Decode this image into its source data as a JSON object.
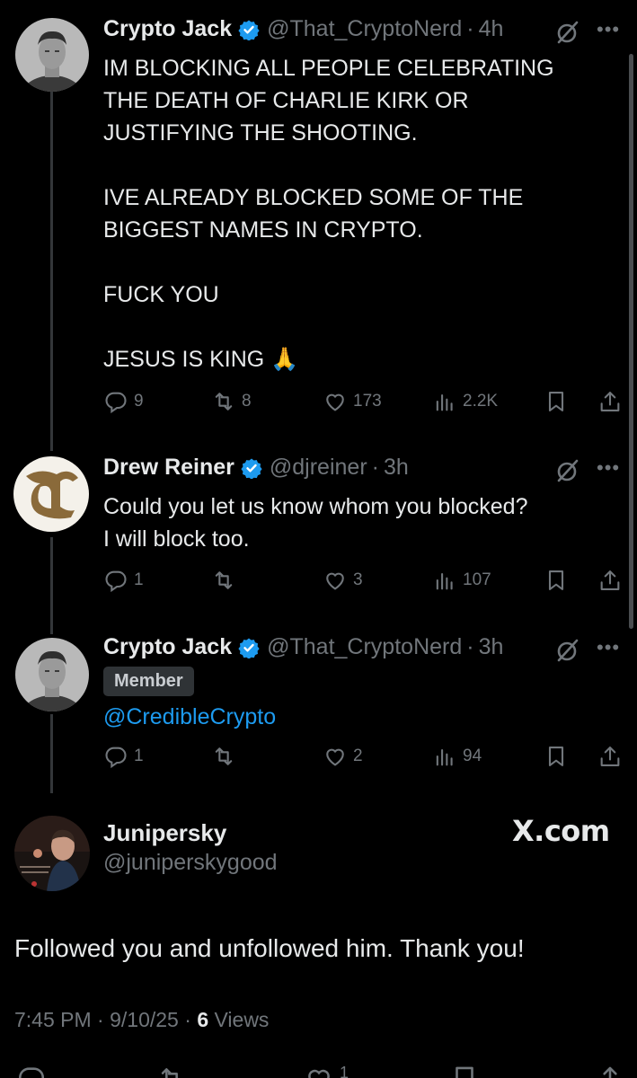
{
  "tweets": [
    {
      "name": "Crypto Jack",
      "handle": "@That_CryptoNerd",
      "time": "4h",
      "text": "IM BLOCKING ALL PEOPLE CELEBRATING\nTHE DEATH OF CHARLIE KIRK OR\nJUSTIFYING THE SHOOTING.\n\nIVE ALREADY BLOCKED SOME OF THE\nBIGGEST NAMES IN CRYPTO.\n\nFUCK YOU\n\nJESUS IS KING 🙏",
      "replies": "9",
      "reposts": "8",
      "likes": "173",
      "views": "2.2K"
    },
    {
      "name": "Drew Reiner",
      "handle": "@djreiner",
      "time": "3h",
      "text": "Could you let us know whom you blocked?\nI will block too.",
      "replies": "1",
      "reposts": "",
      "likes": "3",
      "views": "107"
    },
    {
      "name": "Crypto Jack",
      "handle": "@That_CryptoNerd",
      "time": "3h",
      "badge": "Member",
      "text": "@CredibleCrypto",
      "replies": "1",
      "reposts": "",
      "likes": "2",
      "views": "94"
    }
  ],
  "main_post": {
    "name": "Junipersky",
    "handle": "@juniperskygood",
    "brand": "X.com",
    "text": "Followed you and unfollowed him. Thank you!",
    "time": "7:45 PM",
    "date": "9/10/25",
    "views_count": "6",
    "views_label": "Views",
    "likes": "1"
  },
  "icons": {
    "verified": "verified-badge-icon",
    "grok": "grok-icon",
    "more": "more-icon",
    "reply": "reply-icon",
    "repost": "repost-icon",
    "like": "heart-icon",
    "views": "views-icon",
    "bookmark": "bookmark-icon",
    "share": "share-icon"
  },
  "colors": {
    "background": "#000000",
    "text": "#e7e9ea",
    "muted": "#71767b",
    "link": "#1d9bf0",
    "verified": "#1d9bf0"
  }
}
